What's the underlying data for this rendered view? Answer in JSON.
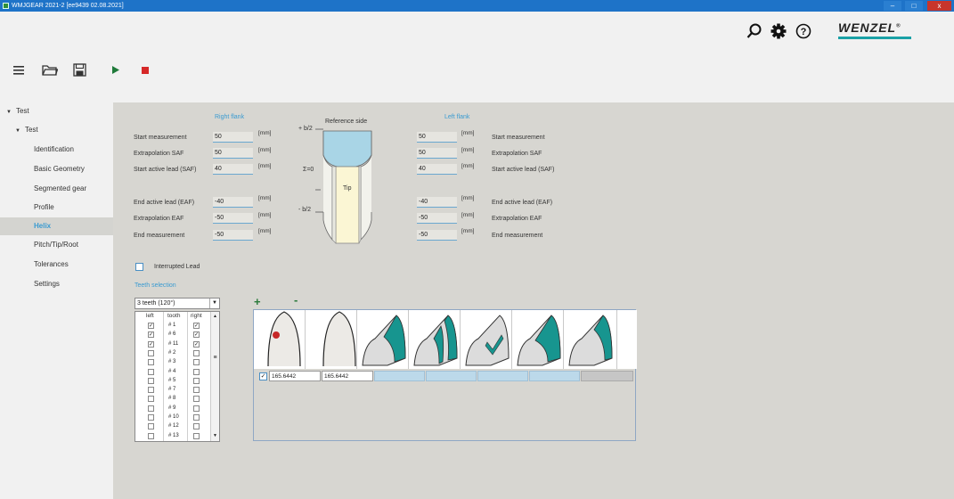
{
  "window": {
    "title": "WMJGEAR 2021-2  [ee9439 02.08.2021]",
    "min_label": "–",
    "max_label": "□",
    "close_label": "x"
  },
  "header": {
    "brand": "WENZEL",
    "brand_mark": "®",
    "icons": [
      "search-icon",
      "gear-icon",
      "help-icon",
      "menu-icon",
      "open-folder-icon",
      "save-icon",
      "play-icon",
      "stop-icon"
    ],
    "colors": {
      "play": "#1f7a3a",
      "stop": "#d62828",
      "accent": "#1aa1a6"
    }
  },
  "sidebar": {
    "root": "Test",
    "group": "Test",
    "items": [
      {
        "label": "Identification"
      },
      {
        "label": "Basic Geometry"
      },
      {
        "label": "Segmented gear"
      },
      {
        "label": "Profile"
      },
      {
        "label": "Helix"
      },
      {
        "label": "Pitch/Tip/Root"
      },
      {
        "label": "Tolerances"
      },
      {
        "label": "Settings"
      }
    ],
    "active": "Helix"
  },
  "helix": {
    "right_flank_title": "Right flank",
    "left_flank_title": "Left flank",
    "reference_side": "Reference side",
    "diagram": {
      "plus_b2": "+ b/2",
      "zero": "Σ=0",
      "minus_b2": "- b/2",
      "tip": "Tip"
    },
    "unit": "[mm]",
    "right": [
      {
        "label": "Start measurement",
        "value": "50"
      },
      {
        "label": "Extrapolation SAF",
        "value": "50"
      },
      {
        "label": "Start active lead (SAF)",
        "value": "40"
      },
      {
        "label": "End active lead (EAF)",
        "value": "-40"
      },
      {
        "label": "Extrapolation EAF",
        "value": "-50"
      },
      {
        "label": "End measurement",
        "value": "-50"
      }
    ],
    "left": [
      {
        "label": "Start measurement",
        "value": "50"
      },
      {
        "label": "Extrapolation SAF",
        "value": "50"
      },
      {
        "label": "Start active lead (SAF)",
        "value": "40"
      },
      {
        "label": "End active lead (EAF)",
        "value": "-40"
      },
      {
        "label": "Extrapolation EAF",
        "value": "-50"
      },
      {
        "label": "End measurement",
        "value": "-50"
      }
    ],
    "interrupted_lead": "Interrupted Lead",
    "teeth_selection_title": "Teeth selection",
    "teeth_select_value": "3 teeth (120°)",
    "teeth_table": {
      "headers": [
        "left",
        "tooth",
        "right"
      ],
      "rows": [
        {
          "tooth": "# 1",
          "left": true,
          "right": true
        },
        {
          "tooth": "# 6",
          "left": true,
          "right": true
        },
        {
          "tooth": "# 11",
          "left": true,
          "right": true
        },
        {
          "tooth": "# 2",
          "left": false,
          "right": false
        },
        {
          "tooth": "# 3",
          "left": false,
          "right": false
        },
        {
          "tooth": "# 4",
          "left": false,
          "right": false
        },
        {
          "tooth": "# 5",
          "left": false,
          "right": false
        },
        {
          "tooth": "# 7",
          "left": false,
          "right": false
        },
        {
          "tooth": "# 8",
          "left": false,
          "right": false
        },
        {
          "tooth": "# 9",
          "left": false,
          "right": false
        },
        {
          "tooth": "# 10",
          "left": false,
          "right": false
        },
        {
          "tooth": "# 12",
          "left": false,
          "right": false
        },
        {
          "tooth": "# 13",
          "left": false,
          "right": false
        }
      ]
    },
    "add_label": "+",
    "remove_label": "-",
    "grid_values": [
      "165.6442",
      "165.6442"
    ]
  }
}
